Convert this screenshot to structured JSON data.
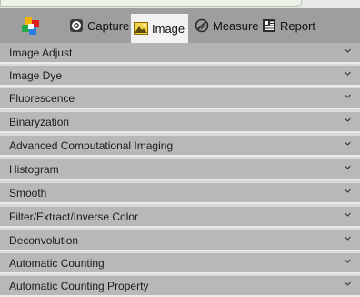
{
  "toolbar": {
    "logo_icon": "app-logo-icon",
    "tabs": [
      {
        "label": "Capture",
        "icon": "capture-icon"
      },
      {
        "label": "Image",
        "icon": "image-icon"
      },
      {
        "label": "Measure",
        "icon": "measure-icon"
      },
      {
        "label": "Report",
        "icon": "report-icon"
      }
    ],
    "active_tab": "Image"
  },
  "panels": [
    {
      "label": "Image Adjust"
    },
    {
      "label": "Image Dye"
    },
    {
      "label": "Fluorescence"
    },
    {
      "label": "Binaryzation"
    },
    {
      "label": "Advanced Computational Imaging"
    },
    {
      "label": "Histogram"
    },
    {
      "label": "Smooth"
    },
    {
      "label": "Filter/Extract/Inverse Color"
    },
    {
      "label": "Deconvolution"
    },
    {
      "label": "Automatic Counting"
    },
    {
      "label": "Automatic Counting Property"
    }
  ],
  "colors": {
    "toolbar_bg": "#9e9e9e",
    "active_tab_bg": "#f2f2f2",
    "row_bg": "#b8b8b8",
    "row_separator": "#ebebeb"
  }
}
